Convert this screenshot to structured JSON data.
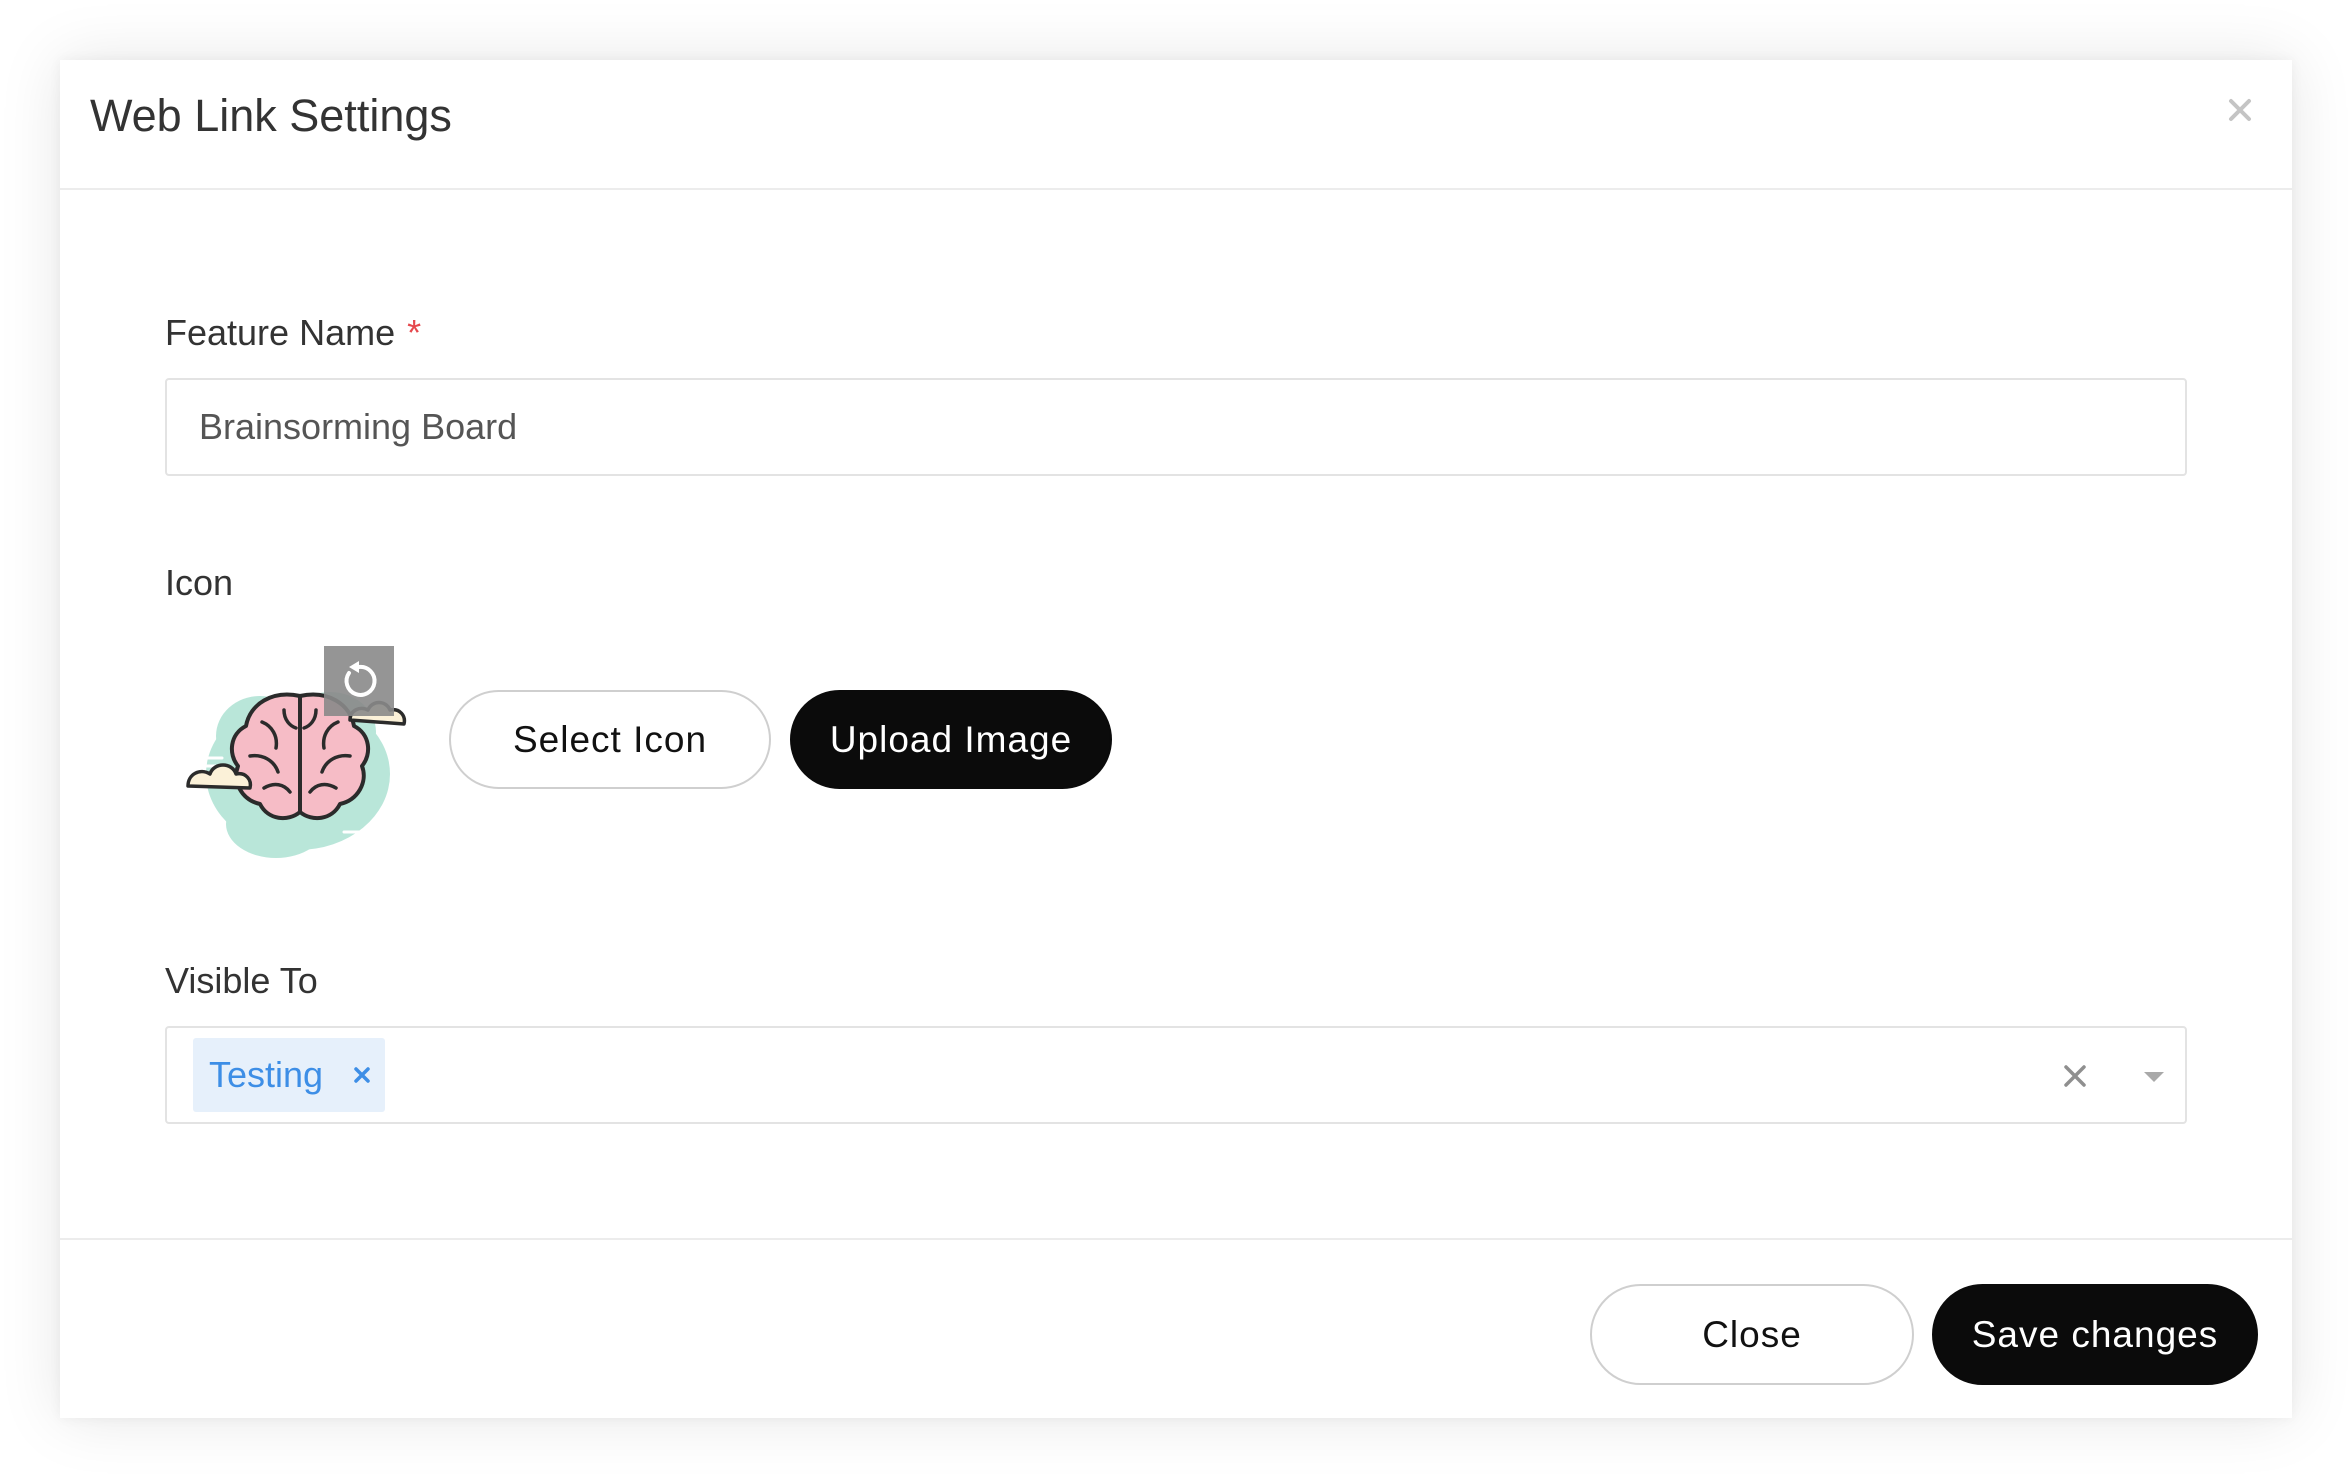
{
  "dialog": {
    "title": "Web Link Settings"
  },
  "feature_name": {
    "label": "Feature Name",
    "required_marker": "*",
    "value": "Brainsorming Board"
  },
  "icon_section": {
    "label": "Icon",
    "preview_icon": "brain-cloud-icon",
    "reset_icon": "reset-icon",
    "select_label": "Select Icon",
    "upload_label": "Upload Image"
  },
  "visible_to": {
    "label": "Visible To",
    "tags": [
      {
        "label": "Testing"
      }
    ]
  },
  "footer": {
    "close_label": "Close",
    "save_label": "Save changes"
  },
  "colors": {
    "accent_dark": "#0b0b0b",
    "required": "#e5484d",
    "tag_background": "#e6f0fb",
    "tag_text": "#3d8ee6"
  }
}
